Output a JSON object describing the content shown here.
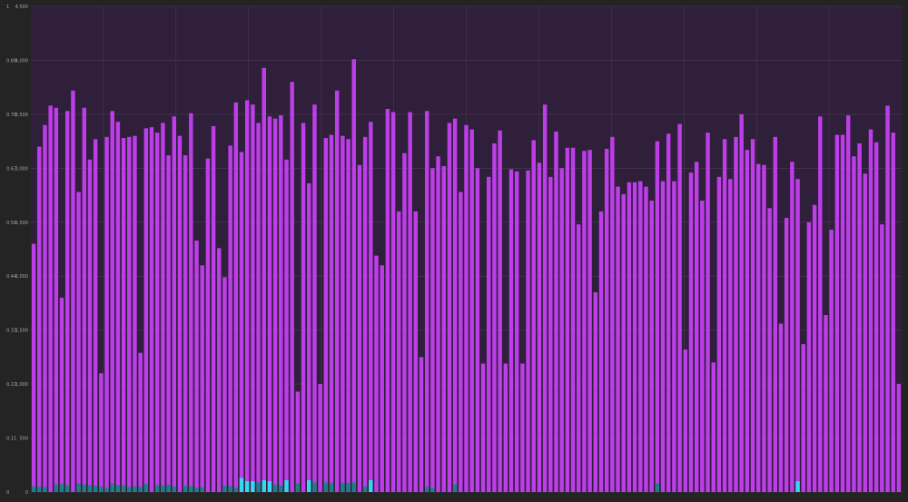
{
  "chart_data": {
    "type": "bar",
    "left_axis": {
      "ticks": [
        "0",
        "0.11",
        "0.22",
        "0.33",
        "0.44",
        "0.56",
        "0.67",
        "0.78",
        "0.89",
        "1"
      ],
      "range": [
        0,
        1
      ]
    },
    "right_axis": {
      "ticks": [
        "0",
        "500",
        "1,000",
        "1,500",
        "2,000",
        "2,500",
        "3,000",
        "3,500",
        "4,000",
        "4,500"
      ],
      "range": [
        0,
        4500
      ]
    },
    "grid": true,
    "colors": {
      "background": "#242424",
      "plot_background": "#2f1f3a",
      "grid": "#4a3d55",
      "primary": "#bd3ee8",
      "secondary": "#1f7f86",
      "secondary_high": "#35d8ee"
    },
    "series": [
      {
        "axis": "right",
        "values": [
          2300,
          3200,
          3400,
          3580,
          3560,
          1800,
          3530,
          3720,
          2780,
          3560,
          3080,
          3270,
          1100,
          3290,
          3530,
          3430,
          3280,
          3290,
          3300,
          1290,
          3370,
          3380,
          3330,
          3420,
          3120,
          3480,
          3300,
          3120,
          3510,
          2330,
          2100,
          3090,
          3390,
          2260,
          1990,
          3210,
          3610,
          3150,
          3630,
          3590,
          3420,
          3930,
          3480,
          3460,
          3490,
          3080,
          3800,
          930,
          3420,
          2860,
          3590,
          1000,
          3280,
          3310,
          3720,
          3300,
          3270,
          4010,
          3030,
          3290,
          3430,
          2190,
          2100,
          3550,
          3520,
          2600,
          3140,
          3520,
          2600,
          1250,
          3530,
          3000,
          3110,
          3020,
          3420,
          3460,
          2780,
          3400,
          3360,
          3000,
          1190,
          2920,
          3230,
          3350,
          1190,
          2990,
          2970,
          1190,
          2980,
          3260,
          3050,
          3590,
          2920,
          3340,
          3000,
          3190,
          3190,
          2480,
          3160,
          3170,
          1850,
          2600,
          3180,
          3290,
          2830,
          2760,
          2870,
          2870,
          2880,
          2830,
          2700,
          3250,
          2880,
          3320,
          2880,
          3410,
          1320,
          2960,
          3060,
          2700,
          3330,
          1200,
          2920,
          3270,
          2900,
          3290,
          3500,
          3170,
          3270,
          3040,
          3030,
          2630,
          3290,
          1560,
          2540,
          3060,
          2900,
          1370,
          2500,
          2660,
          3480,
          1640,
          2430,
          3310,
          3310,
          3490,
          3110,
          3230,
          2950,
          3360,
          3240,
          2480,
          3580,
          3330,
          1000
        ]
      },
      {
        "axis": "right",
        "values": [
          55,
          50,
          45,
          0,
          70,
          75,
          65,
          0,
          80,
          70,
          65,
          60,
          50,
          40,
          80,
          65,
          60,
          45,
          55,
          50,
          75,
          0,
          65,
          60,
          70,
          50,
          0,
          60,
          55,
          40,
          45,
          0,
          0,
          0,
          60,
          55,
          40,
          130,
          100,
          100,
          90,
          110,
          100,
          70,
          60,
          110,
          0,
          80,
          0,
          110,
          90,
          0,
          90,
          85,
          0,
          85,
          85,
          90,
          0,
          50,
          110,
          0,
          0,
          0,
          0,
          0,
          0,
          0,
          0,
          0,
          50,
          40,
          0,
          0,
          0,
          70,
          0,
          0,
          0,
          0,
          0,
          0,
          0,
          0,
          0,
          0,
          0,
          0,
          0,
          0,
          0,
          0,
          0,
          0,
          0,
          0,
          0,
          0,
          0,
          0,
          0,
          0,
          0,
          0,
          0,
          0,
          0,
          0,
          0,
          0,
          0,
          80,
          0,
          0,
          0,
          0,
          0,
          0,
          0,
          0,
          0,
          0,
          0,
          0,
          0,
          0,
          0,
          0,
          0,
          0,
          0,
          0,
          0,
          0,
          0,
          0,
          100,
          0,
          0,
          0,
          0,
          0,
          0,
          0,
          0,
          0,
          0,
          0,
          0,
          0,
          0,
          0,
          0,
          0,
          0,
          0,
          0,
          0,
          0,
          0,
          0
        ]
      }
    ]
  }
}
